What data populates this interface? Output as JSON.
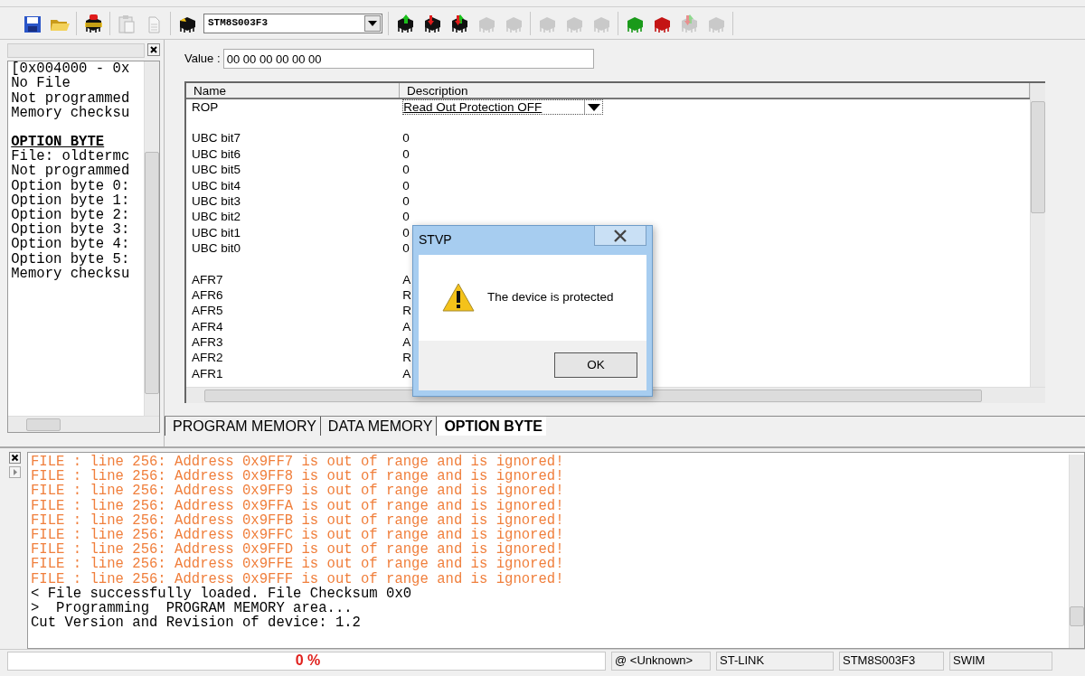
{
  "toolbar": {
    "groups": [
      [
        {
          "kind": "save",
          "disabled": false
        },
        {
          "kind": "open",
          "disabled": false
        }
      ],
      [
        {
          "kind": "chip-alert",
          "disabled": false
        }
      ],
      [
        {
          "kind": "paste",
          "disabled": true
        },
        {
          "kind": "document",
          "disabled": true
        }
      ],
      [
        {
          "kind": "chip-marked",
          "disabled": false
        },
        {
          "kind": "combo",
          "value": "STM8S003F3"
        }
      ],
      [
        {
          "kind": "chip-up",
          "disabled": false
        },
        {
          "kind": "chip-down",
          "disabled": false
        },
        {
          "kind": "chip-updown",
          "disabled": false
        },
        {
          "kind": "chip-plain",
          "disabled": true
        },
        {
          "kind": "chip-plain",
          "disabled": true
        }
      ],
      [
        {
          "kind": "chip-plain",
          "disabled": true
        },
        {
          "kind": "chip-plain",
          "disabled": true
        },
        {
          "kind": "chip-plain",
          "disabled": true
        }
      ],
      [
        {
          "kind": "chip-green",
          "disabled": false
        },
        {
          "kind": "chip-red",
          "disabled": false
        },
        {
          "kind": "chip-updown",
          "disabled": true
        },
        {
          "kind": "chip-plain",
          "disabled": true
        }
      ]
    ]
  },
  "info_pane": {
    "lines": [
      {
        "text": "[0x004000 - 0x",
        "heading": false
      },
      {
        "text": "No File",
        "heading": false
      },
      {
        "text": "Not programmed",
        "heading": false
      },
      {
        "text": "Memory checksu",
        "heading": false
      },
      {
        "text": "OPTION BYTE",
        "heading": true
      },
      {
        "text": "File: oldtermc",
        "heading": false
      },
      {
        "text": "Not programmed",
        "heading": false
      },
      {
        "text": "Option byte 0:",
        "heading": false
      },
      {
        "text": "Option byte 1:",
        "heading": false
      },
      {
        "text": "Option byte 2:",
        "heading": false
      },
      {
        "text": "Option byte 3:",
        "heading": false
      },
      {
        "text": "Option byte 4:",
        "heading": false
      },
      {
        "text": "Option byte 5:",
        "heading": false
      },
      {
        "text": "Memory checksu",
        "heading": false
      }
    ]
  },
  "value_field": {
    "label": "Value :",
    "value": "00 00 00 00 00 00"
  },
  "table": {
    "columns": [
      "Name",
      "Description"
    ],
    "groups": [
      [
        {
          "name": "ROP",
          "kind": "combo",
          "description": "Read Out Protection OFF"
        }
      ],
      [
        {
          "name": "UBC bit7",
          "kind": "text",
          "description": "0"
        },
        {
          "name": "UBC bit6",
          "kind": "text",
          "description": "0"
        },
        {
          "name": "UBC bit5",
          "kind": "text",
          "description": "0"
        },
        {
          "name": "UBC bit4",
          "kind": "text",
          "description": "0"
        },
        {
          "name": "UBC bit3",
          "kind": "text",
          "description": "0"
        },
        {
          "name": "UBC bit2",
          "kind": "text",
          "description": "0"
        },
        {
          "name": "UBC bit1",
          "kind": "text",
          "description": "0"
        },
        {
          "name": "UBC bit0",
          "kind": "text",
          "description": "0"
        }
      ],
      [
        {
          "name": "AFR7",
          "kind": "text",
          "description": "A"
        },
        {
          "name": "AFR6",
          "kind": "text",
          "description": "R"
        },
        {
          "name": "AFR5",
          "kind": "text",
          "description": "R"
        },
        {
          "name": "AFR4",
          "kind": "text",
          "description": "A"
        },
        {
          "name": "AFR3",
          "kind": "text",
          "description": "A"
        },
        {
          "name": "AFR2",
          "kind": "text",
          "description": "R"
        },
        {
          "name": "AFR1",
          "kind": "text",
          "description": "A"
        }
      ]
    ]
  },
  "tabs": [
    {
      "label": "PROGRAM MEMORY",
      "selected": false
    },
    {
      "label": "DATA MEMORY",
      "selected": false
    },
    {
      "label": "OPTION BYTE",
      "selected": true
    }
  ],
  "dialog": {
    "title": "STVP",
    "message": "The device is protected",
    "button": "OK"
  },
  "log": {
    "lines": [
      {
        "text": "FILE : line 256: Address 0x9FF7 is out of range and is ignored!",
        "kind": "warning"
      },
      {
        "text": "FILE : line 256: Address 0x9FF8 is out of range and is ignored!",
        "kind": "warning"
      },
      {
        "text": "FILE : line 256: Address 0x9FF9 is out of range and is ignored!",
        "kind": "warning"
      },
      {
        "text": "FILE : line 256: Address 0x9FFA is out of range and is ignored!",
        "kind": "warning"
      },
      {
        "text": "FILE : line 256: Address 0x9FFB is out of range and is ignored!",
        "kind": "warning"
      },
      {
        "text": "FILE : line 256: Address 0x9FFC is out of range and is ignored!",
        "kind": "warning"
      },
      {
        "text": "FILE : line 256: Address 0x9FFD is out of range and is ignored!",
        "kind": "warning"
      },
      {
        "text": "FILE : line 256: Address 0x9FFE is out of range and is ignored!",
        "kind": "warning"
      },
      {
        "text": "FILE : line 256: Address 0x9FFF is out of range and is ignored!",
        "kind": "warning"
      },
      {
        "text": "< File successfully loaded. File Checksum 0x0",
        "kind": "info"
      },
      {
        "text": ">  Programming  PROGRAM MEMORY area...",
        "kind": "info"
      },
      {
        "text": "Cut Version and Revision of device: 1.2",
        "kind": "info"
      }
    ]
  },
  "status_bar": {
    "progress": "0 %",
    "panels": [
      "@ <Unknown>",
      "ST-LINK",
      "STM8S003F3",
      "SWIM"
    ]
  }
}
